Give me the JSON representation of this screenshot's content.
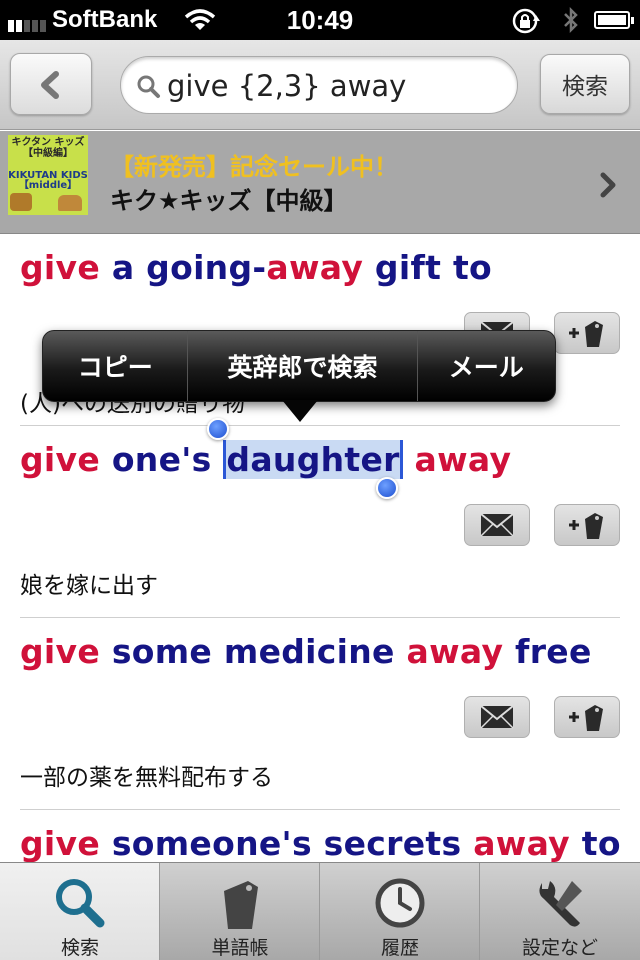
{
  "status_bar": {
    "carrier": "SoftBank",
    "time": "10:49"
  },
  "navbar": {
    "search_value": "give {2,3} away",
    "search_button": "検索"
  },
  "banner": {
    "image_text_top": "キクタン キッズ 【中級編】",
    "image_text_bottom": "KIKUTAN KIDS 【middle】",
    "title": "【新発売】記念セール中！",
    "subtitle": "キク★キッズ【中級】"
  },
  "entries": [
    {
      "words": [
        {
          "text": "give",
          "color": "red"
        },
        {
          "text": " a going-",
          "color": "blue"
        },
        {
          "text": "away",
          "color": "red"
        },
        {
          "text": " gift to",
          "color": "blue"
        }
      ],
      "translation": "(人)への送別の贈り物"
    },
    {
      "words": [
        {
          "text": "give",
          "color": "red"
        },
        {
          "text": " one's ",
          "color": "blue"
        },
        {
          "text": "daughter",
          "color": "blue",
          "selected": true
        },
        {
          "text": " away",
          "color": "red"
        }
      ],
      "translation": "娘を嫁に出す"
    },
    {
      "words": [
        {
          "text": "give",
          "color": "red"
        },
        {
          "text": " some medicine ",
          "color": "blue"
        },
        {
          "text": "away",
          "color": "red"
        },
        {
          "text": " free",
          "color": "blue"
        }
      ],
      "translation": "一部の薬を無料配布する"
    },
    {
      "words": [
        {
          "text": "give",
          "color": "red"
        },
        {
          "text": " someone's secrets ",
          "color": "blue"
        },
        {
          "text": "away",
          "color": "red"
        },
        {
          "text": " to",
          "color": "blue"
        }
      ],
      "translation": ""
    }
  ],
  "context_menu": {
    "items": [
      "コピー",
      "英辞郎で検索",
      "メール"
    ]
  },
  "tabs": [
    {
      "label": "検索",
      "icon": "search-icon",
      "active": true
    },
    {
      "label": "単語帳",
      "icon": "wordbook-tag-icon",
      "active": false
    },
    {
      "label": "履歴",
      "icon": "clock-icon",
      "active": false
    },
    {
      "label": "設定など",
      "icon": "wrench-icon",
      "active": false
    }
  ],
  "colors": {
    "keyword_red": "#d0113a",
    "phrase_blue": "#151585",
    "banner_title": "#f0c020",
    "selection_handle": "#1c4ed0",
    "active_tab_icon": "#1e6f8f"
  }
}
